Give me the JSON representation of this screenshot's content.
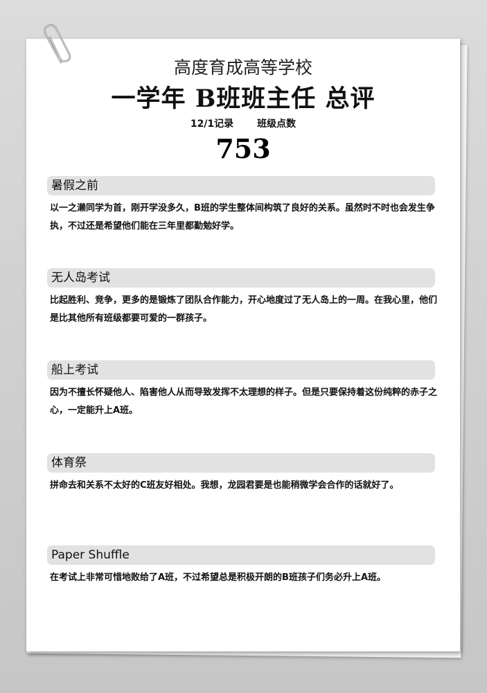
{
  "document": {
    "school": "高度育成高等学校",
    "title": "一学年 B班班主任  总评",
    "record_label": "12/1记录",
    "points_label": "班级点数",
    "points_value": "753"
  },
  "sections": [
    {
      "heading": "暑假之前",
      "body": "以一之濑同学为首，刚开学没多久，B班的学生整体间构筑了良好的关系。虽然时不时也会发生争执，不过还是希望他们能在三年里都勤勉好学。"
    },
    {
      "heading": "无人岛考试",
      "body": "比起胜利、竞争，更多的是锻炼了团队合作能力，开心地度过了无人岛上的一周。在我心里，他们是比其他所有班级都要可爱的一群孩子。"
    },
    {
      "heading": "船上考试",
      "body": "因为不擅长怀疑他人、陷害他人从而导致发挥不太理想的样子。但是只要保持着这份纯粹的赤子之心，一定能升上A班。"
    },
    {
      "heading": "体育祭",
      "body": "拼命去和关系不太好的C班友好相处。我想，龙园君要是也能稍微学会合作的话就好了。"
    },
    {
      "heading": "Paper Shuffle",
      "body": "在考试上非常可惜地败给了A班，不过希望总是积极开朗的B班孩子们务必升上A班。"
    }
  ],
  "colors": {
    "header_band": "#e2e2e2",
    "paper": "#ffffff",
    "background": "#d2d2d2"
  },
  "icons": {
    "clip": "paperclip-icon"
  }
}
